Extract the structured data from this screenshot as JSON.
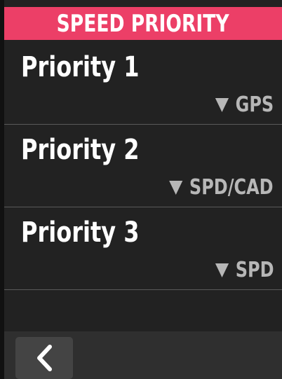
{
  "header": {
    "title": "SPEED PRIORITY"
  },
  "priorities": [
    {
      "label": "Priority 1",
      "value": "GPS"
    },
    {
      "label": "Priority 2",
      "value": "SPD/CAD"
    },
    {
      "label": "Priority 3",
      "value": "SPD"
    }
  ],
  "footer": {
    "back_icon": "chevron-left-icon"
  },
  "colors": {
    "header_bg": "#ec3f67",
    "background": "#222222",
    "value_text": "#b7b7b7",
    "footer_bg": "#2f2f2f",
    "back_button_bg": "#444444"
  }
}
